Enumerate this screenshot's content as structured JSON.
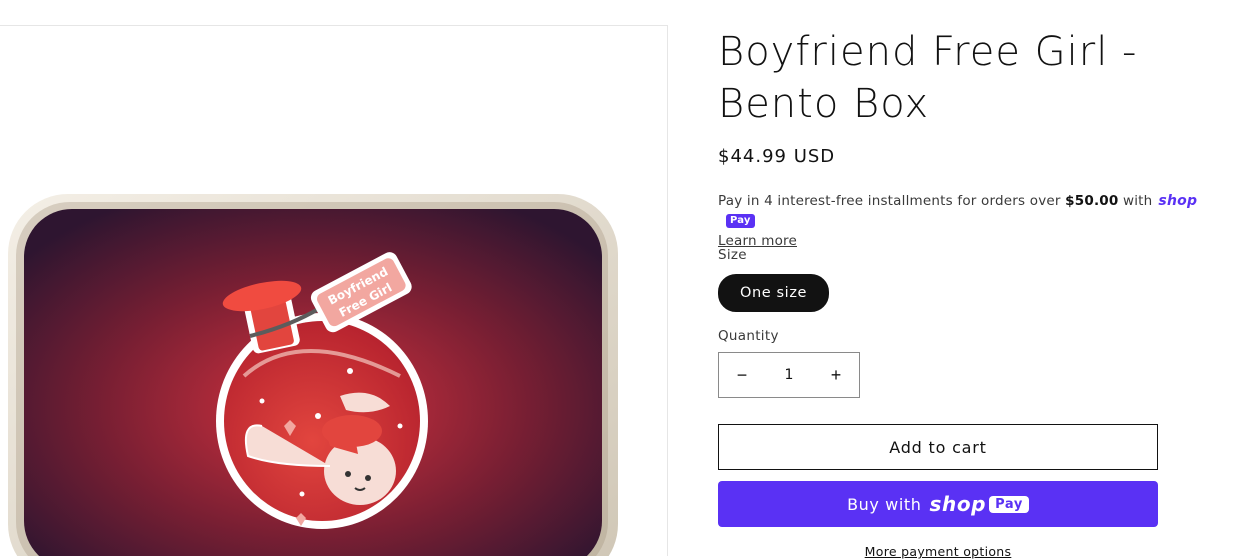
{
  "product": {
    "title": "Boyfriend Free Girl - Bento Box",
    "price": "$44.99 USD",
    "image_text": [
      "Boyfriend",
      "Free Girl"
    ]
  },
  "installments": {
    "prefix": "Pay in 4 interest-free installments for orders over",
    "threshold": "$50.00",
    "suffix": "with",
    "brand": "shop",
    "badge": "Pay",
    "learn_more": "Learn more"
  },
  "size": {
    "label": "Size",
    "selected": "One size"
  },
  "quantity": {
    "label": "Quantity",
    "value": "1",
    "decrease_symbol": "−",
    "increase_symbol": "+"
  },
  "actions": {
    "add_to_cart": "Add to cart",
    "buy_with": "Buy with",
    "shop_word": "shop",
    "pay_word": "Pay",
    "more_options": "More payment options"
  },
  "colors": {
    "shop_purple": "#5a31f4",
    "text": "#121212",
    "pill_bg": "#121212"
  }
}
